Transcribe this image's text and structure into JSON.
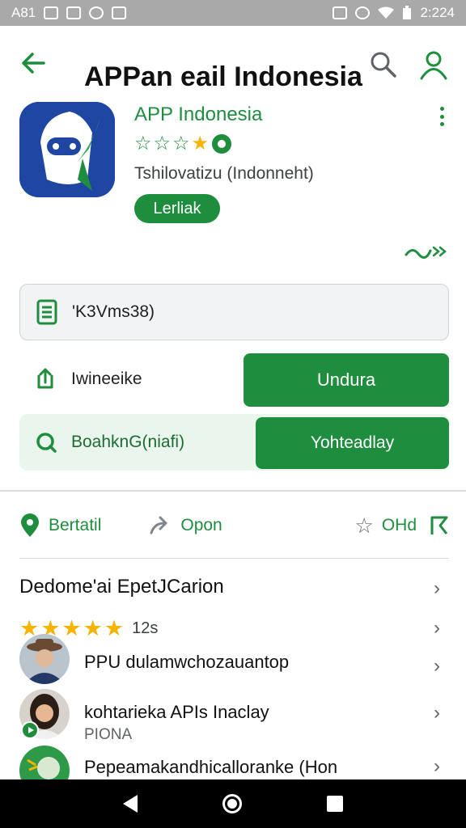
{
  "status_bar": {
    "carrier": "A81",
    "time": "2:224"
  },
  "header": {
    "title": "APPan eail Indonesia"
  },
  "app": {
    "name": "APP Indonesia",
    "developer": "Tshilovatizu (Indonneht)",
    "tag": "Lerliak"
  },
  "info_box": {
    "text": "'K3Vms38)"
  },
  "install_row": {
    "label": "Iwineeike",
    "button_label": "Undura"
  },
  "open_row": {
    "label": "BoahknG(niafi)",
    "button_label": "Yohteadlay"
  },
  "actions": {
    "detail_label": "Bertatil",
    "share_label": "Opon",
    "wishlist_label": "OHd"
  },
  "reviews": {
    "section_title": "Dedome'ai EpetJCarion",
    "rating_count": "12s",
    "items": [
      {
        "name": "PPU dulamwchozauantop",
        "sub": ""
      },
      {
        "name": "kohtarieka APIs Inaclay",
        "sub": "PIONA"
      },
      {
        "name": "Pepeamakandhicalloranke (Hon",
        "sub": ""
      }
    ]
  },
  "colors": {
    "accent": "#1e8e3e",
    "star": "#f4b400",
    "app_icon_bg": "#1f46a3"
  }
}
